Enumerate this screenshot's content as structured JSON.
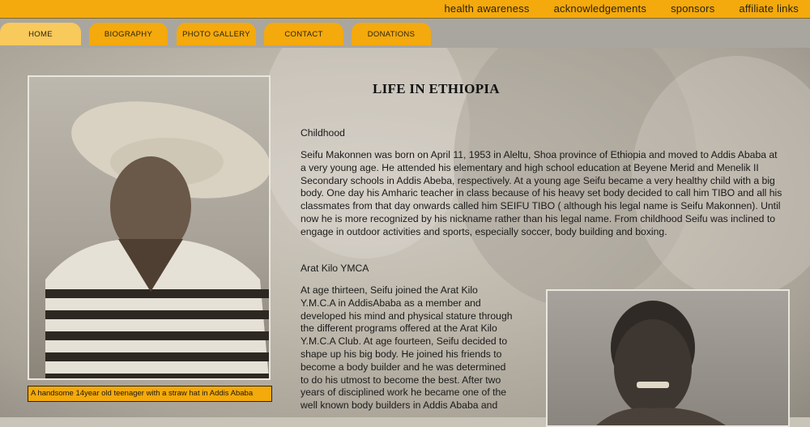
{
  "top_links": [
    "health awareness",
    "acknowledgements",
    "sponsors",
    "affiliate links"
  ],
  "nav_tabs": [
    "HOME",
    "BIOGRAPHY",
    "PHOTO GALLERY",
    "CONTACT",
    "DONATIONS"
  ],
  "page_title": "LIFE IN ETHIOPIA",
  "photo_caption": "A handsome 14year old teenager with a straw hat in Addis Ababa",
  "sections": {
    "childhood_title": "Childhood",
    "childhood_text": "Seifu Makonnen was born on April 11, 1953 in Aleltu, Shoa province of Ethiopia and moved to Addis Ababa at a very young age. He attended his elementary and high school education at Beyene Merid and Menelik II Secondary schools in Addis Abeba, respectively. At a young age Seifu became a very healthy child with a big body. One day his Amharic teacher in class because of his heavy set body decided to call him TIBO and all his classmates from that day onwards called him SEIFU TIBO ( although his legal name is Seifu Makonnen). Until now he is more recognized by his nickname rather than his legal name. From childhood Seifu was inclined to engage in outdoor activities and sports, especially soccer, body building and boxing.",
    "ymca_title": "Arat Kilo YMCA",
    "ymca_text": "At age thirteen, Seifu joined the Arat Kilo Y.M.C.A in AddisAbaba as a member and developed his mind and physical stature through the different programs offered at the Arat Kilo Y.M.C.A Club. At age fourteen, Seifu decided to shape up his big body. He joined his friends to become a body builder and he was determined to do his utmost to become the best. After two years of disciplined work he became one of the well known body builders in Addis Ababa and"
  }
}
